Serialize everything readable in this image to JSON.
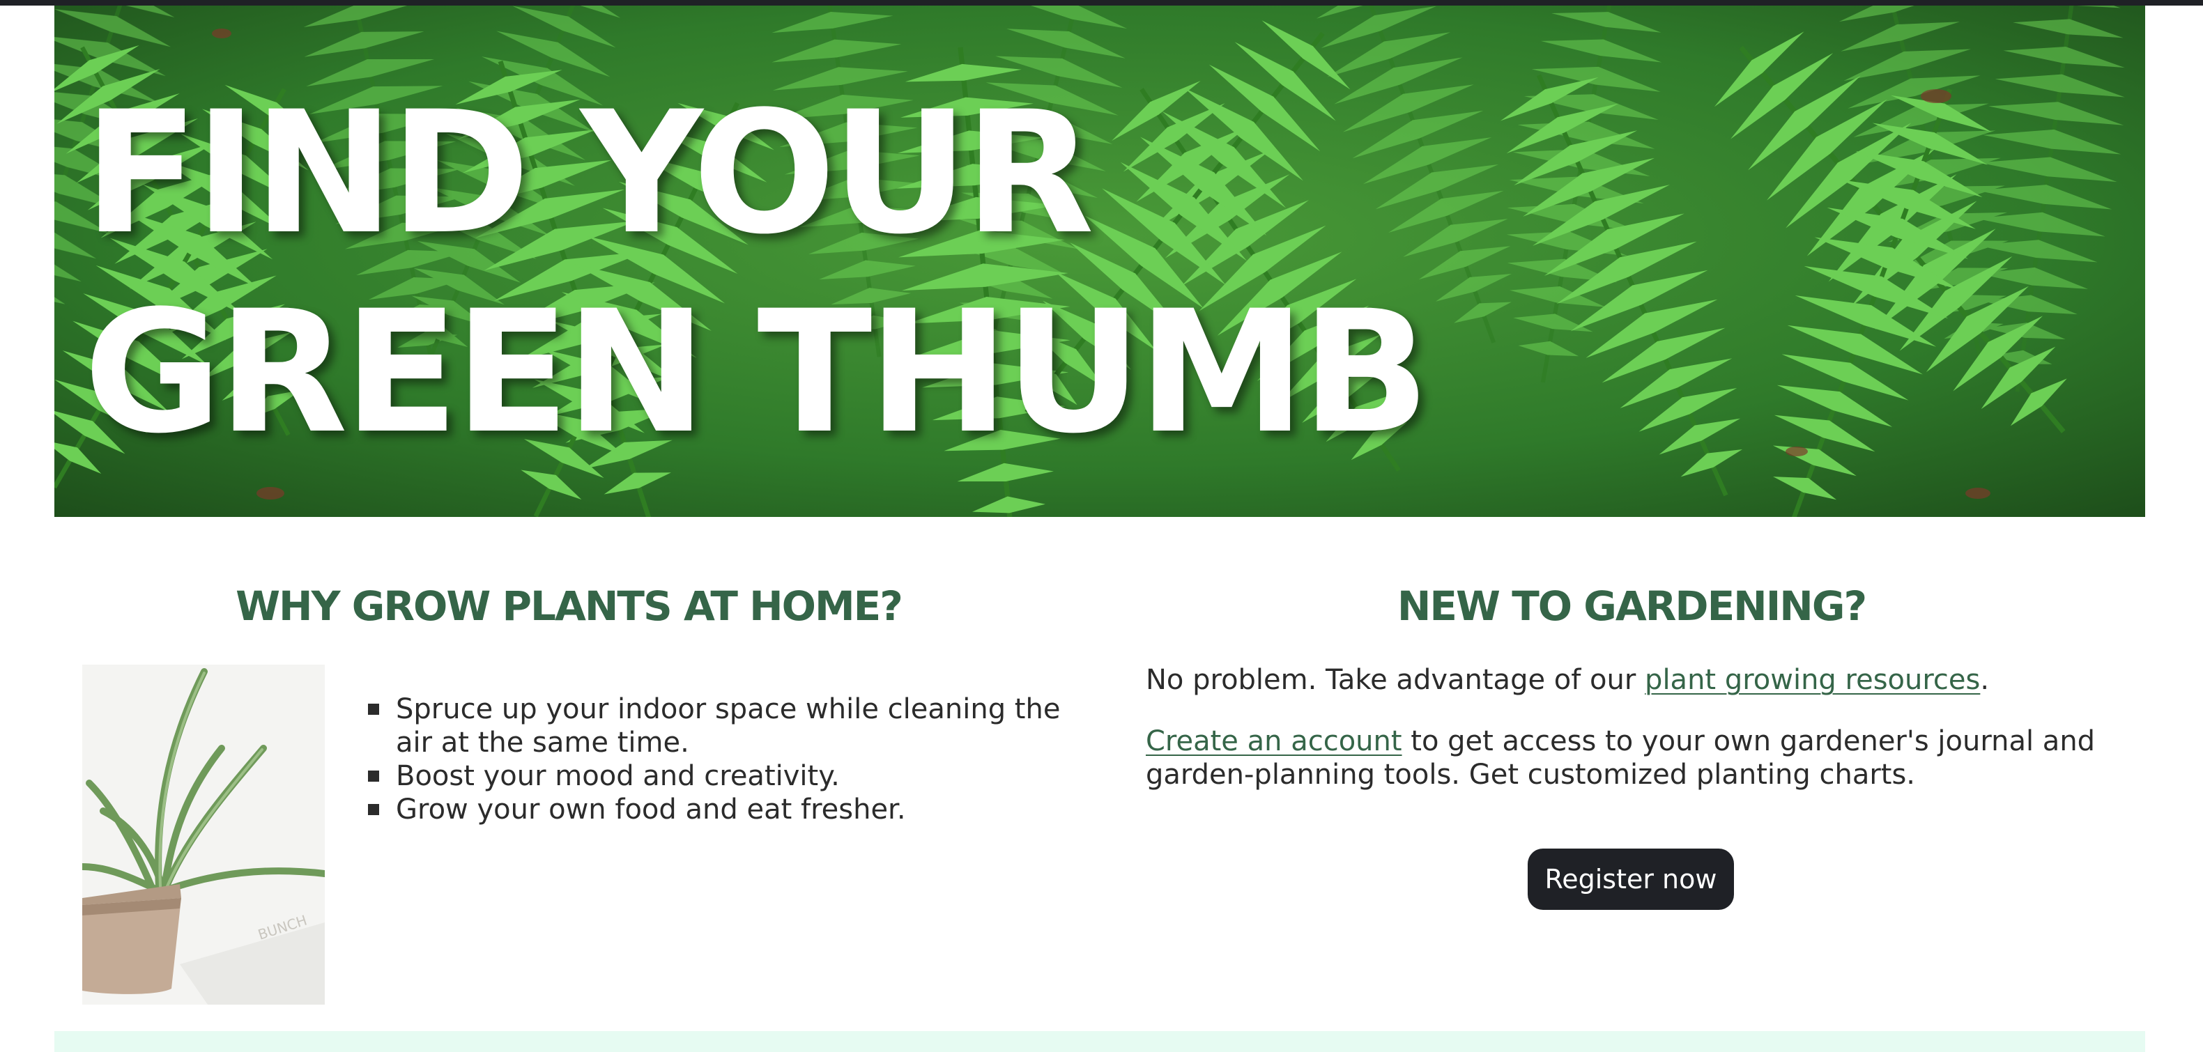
{
  "hero": {
    "title": "FIND YOUR GREEN THUMB"
  },
  "why_section": {
    "heading": "WHY GROW PLANTS AT HOME?",
    "benefits": [
      "Spruce up your indoor space while cleaning the air at the same time.",
      "Boost your mood and creativity.",
      "Grow your own food and eat fresher."
    ]
  },
  "new_section": {
    "heading": "NEW TO GARDENING?",
    "intro_text": "No problem. Take advantage of our ",
    "resources_link": "plant growing resources",
    "intro_end": ".",
    "account_link": "Create an account",
    "account_text": " to get access to your own gardener's journal and garden-planning tools. Get customized planting charts.",
    "register_button": "Register now"
  },
  "photo": {
    "pot_text": "BUNCH"
  },
  "colors": {
    "heading_green": "#356548",
    "button_dark": "#1f2126",
    "mint_band": "#e6fbf2"
  }
}
